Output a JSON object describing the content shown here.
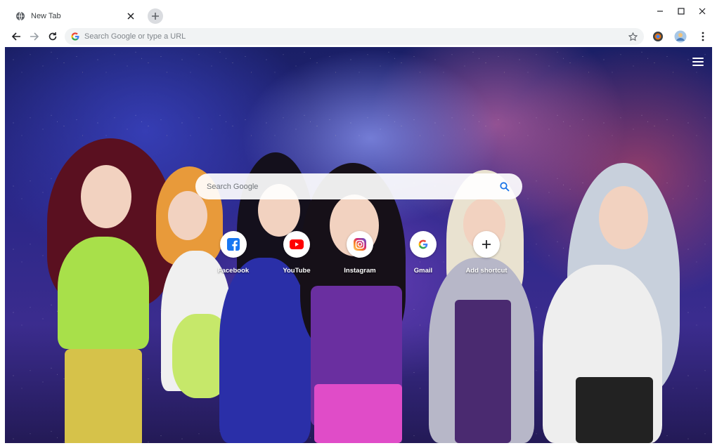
{
  "browser": {
    "tab": {
      "title": "New Tab"
    },
    "omnibox": {
      "placeholder": "Search Google or type a URL"
    }
  },
  "page": {
    "search": {
      "placeholder": "Search Google"
    },
    "shortcuts": [
      {
        "label": "Facebook",
        "icon": "facebook-icon",
        "color": "#1877f2"
      },
      {
        "label": "YouTube",
        "icon": "youtube-icon",
        "color": "#ff0000"
      },
      {
        "label": "Instagram",
        "icon": "instagram-icon",
        "color": "#c13584"
      },
      {
        "label": "Gmail",
        "icon": "google-icon",
        "color": "#4285f4"
      },
      {
        "label": "Add shortcut",
        "icon": "plus-icon",
        "color": "#202124"
      }
    ]
  },
  "colors": {
    "accent": "#1a73e8",
    "omnibox_bg": "#f1f3f4"
  }
}
